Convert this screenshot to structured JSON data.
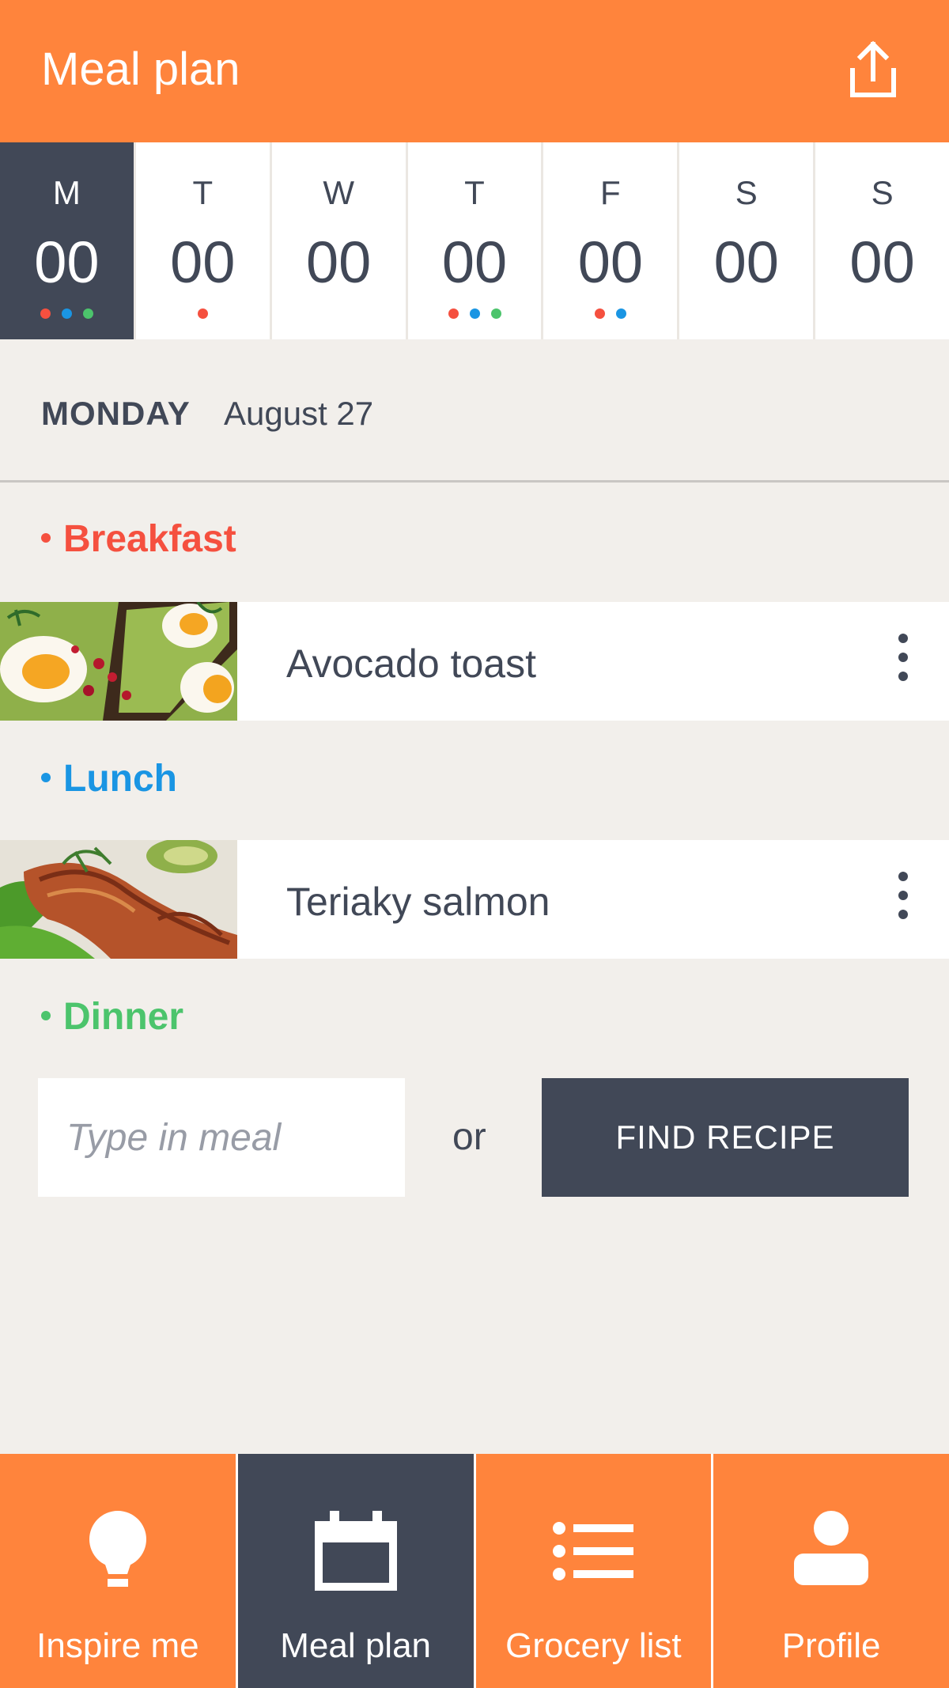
{
  "header": {
    "title": "Meal plan",
    "share_icon": "share-icon"
  },
  "week": [
    {
      "letter": "M",
      "number": "00",
      "selected": true,
      "dots": [
        "#f5503f",
        "#1a95e3",
        "#4cc46c"
      ]
    },
    {
      "letter": "T",
      "number": "00",
      "selected": false,
      "dots": [
        "#f5503f"
      ]
    },
    {
      "letter": "W",
      "number": "00",
      "selected": false,
      "dots": []
    },
    {
      "letter": "T",
      "number": "00",
      "selected": false,
      "dots": [
        "#f5503f",
        "#1a95e3",
        "#4cc46c"
      ]
    },
    {
      "letter": "F",
      "number": "00",
      "selected": false,
      "dots": [
        "#f5503f",
        "#1a95e3"
      ]
    },
    {
      "letter": "S",
      "number": "00",
      "selected": false,
      "dots": []
    },
    {
      "letter": "S",
      "number": "00",
      "selected": false,
      "dots": []
    }
  ],
  "date": {
    "weekday": "MONDAY",
    "full": "August 27"
  },
  "meals": {
    "breakfast": {
      "label": "Breakfast",
      "color": "#f5503f",
      "item": {
        "name": "Avocado toast",
        "more_icon": "more-vertical-icon"
      }
    },
    "lunch": {
      "label": "Lunch",
      "color": "#1a95e3",
      "item": {
        "name": "Teriaky salmon",
        "more_icon": "more-vertical-icon"
      }
    },
    "dinner": {
      "label": "Dinner",
      "color": "#4cc46c",
      "input_placeholder": "Type in meal",
      "or_text": "or",
      "find_button": "FIND RECIPE"
    }
  },
  "nav": [
    {
      "label": "Inspire me",
      "icon": "lightbulb-icon",
      "active": false
    },
    {
      "label": "Meal plan",
      "icon": "calendar-icon",
      "active": true
    },
    {
      "label": "Grocery list",
      "icon": "list-icon",
      "active": false
    },
    {
      "label": "Profile",
      "icon": "profile-icon",
      "active": false
    }
  ],
  "colors": {
    "brand_orange": "#ff843c",
    "dark_slate": "#414857",
    "background": "#f2efeb",
    "breakfast_red": "#f5503f",
    "lunch_blue": "#1a95e3",
    "dinner_green": "#4cc46c"
  }
}
